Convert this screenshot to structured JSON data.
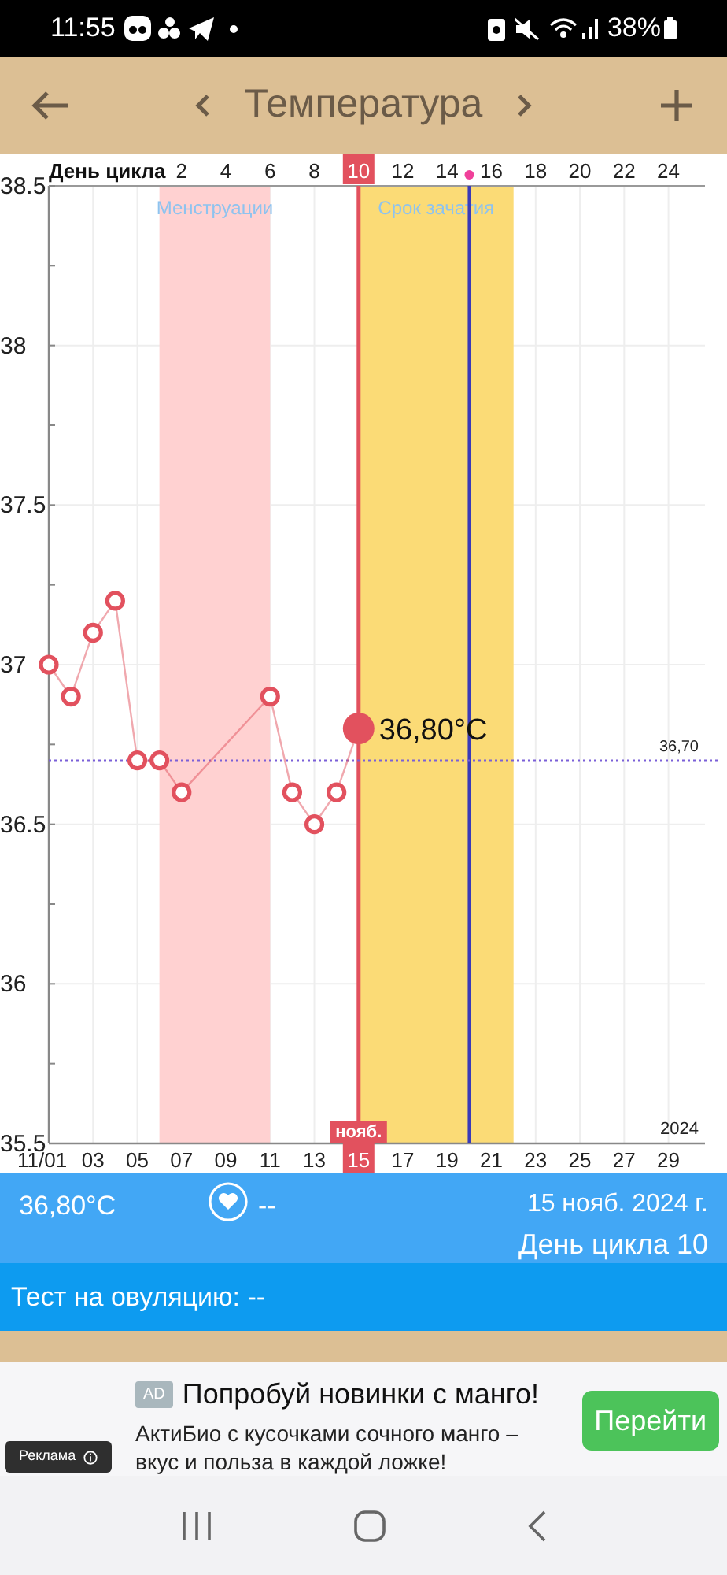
{
  "status_bar": {
    "time": "11:55",
    "battery": "38%"
  },
  "header": {
    "title": "Температура"
  },
  "chart": {
    "chart_data": {
      "type": "line",
      "x": [
        1,
        2,
        3,
        4,
        5,
        6,
        7,
        11,
        12,
        13,
        14,
        15
      ],
      "series": [
        {
          "color": "#e2515e",
          "marker": "o",
          "values": [
            37.0,
            36.9,
            37.1,
            37.2,
            36.7,
            36.7,
            36.6,
            36.9,
            36.6,
            36.5,
            36.6,
            36.8
          ]
        }
      ],
      "grid": true,
      "xlim": [
        1,
        30.65
      ],
      "ylim": [
        35.5,
        38.5
      ],
      "yticks": [
        35.5,
        36,
        36.5,
        37,
        37.5,
        38,
        38.5
      ],
      "xticks": [
        {
          "value": 1,
          "label": "11/01"
        },
        {
          "value": 3,
          "label": "03"
        },
        {
          "value": 5,
          "label": "05"
        },
        {
          "value": 7,
          "label": "07"
        },
        {
          "value": 9,
          "label": "09"
        },
        {
          "value": 11,
          "label": "11"
        },
        {
          "value": 13,
          "label": "13"
        },
        {
          "value": 15,
          "label": "15"
        },
        {
          "value": 17,
          "label": "17"
        },
        {
          "value": 19,
          "label": "19"
        },
        {
          "value": 21,
          "label": "21"
        },
        {
          "value": 23,
          "label": "23"
        },
        {
          "value": 25,
          "label": "25"
        },
        {
          "value": 27,
          "label": "27"
        },
        {
          "value": 29,
          "label": "29"
        }
      ],
      "bands": [
        {
          "axis": "x",
          "from": 6,
          "to": 11,
          "color": "#ffd1d1",
          "label": "Менструации"
        },
        {
          "axis": "x",
          "from": 15,
          "to": 22,
          "color": "#fbdb76",
          "label": "Срок зачатия"
        }
      ],
      "ref_lines": [
        {
          "axis": "x",
          "value": 15,
          "color": "#e2515e"
        },
        {
          "axis": "x",
          "value": 20,
          "color": "#3a3ab8"
        },
        {
          "axis": "y",
          "value": 36.7,
          "color": "#7a5fd8",
          "label": "36,70"
        }
      ],
      "annotations": [
        {
          "x": 15,
          "y": 36.8,
          "text": "36,80°C"
        }
      ]
    },
    "cycle_axis": {
      "label": "День цикла",
      "ticks": [
        {
          "label": "2",
          "selected": false
        },
        {
          "label": "4",
          "selected": false
        },
        {
          "label": "6",
          "selected": false
        },
        {
          "label": "8",
          "selected": false
        },
        {
          "label": "10",
          "selected": true
        },
        {
          "label": "12",
          "selected": false
        },
        {
          "label": "14",
          "selected": false
        },
        {
          "label": "16",
          "selected": false
        },
        {
          "label": "18",
          "selected": false
        },
        {
          "label": "20",
          "selected": false
        },
        {
          "label": "22",
          "selected": false
        },
        {
          "label": "24",
          "selected": false
        }
      ]
    },
    "month": "нояб.",
    "year": "2024"
  },
  "info": {
    "temperature": "36,80°C",
    "note": "--",
    "date": "15 нояб. 2024 г.",
    "cycle_day": "День цикла 10"
  },
  "ovulation_test": "Тест на овуляцию: --",
  "ad": {
    "badge": "AD",
    "title": "Попробуй новинки с манго!",
    "body": "АктиБио с кусочками сочного манго – вкус и польза в каждой ложке!",
    "button": "Перейти",
    "label": "Реклама"
  }
}
